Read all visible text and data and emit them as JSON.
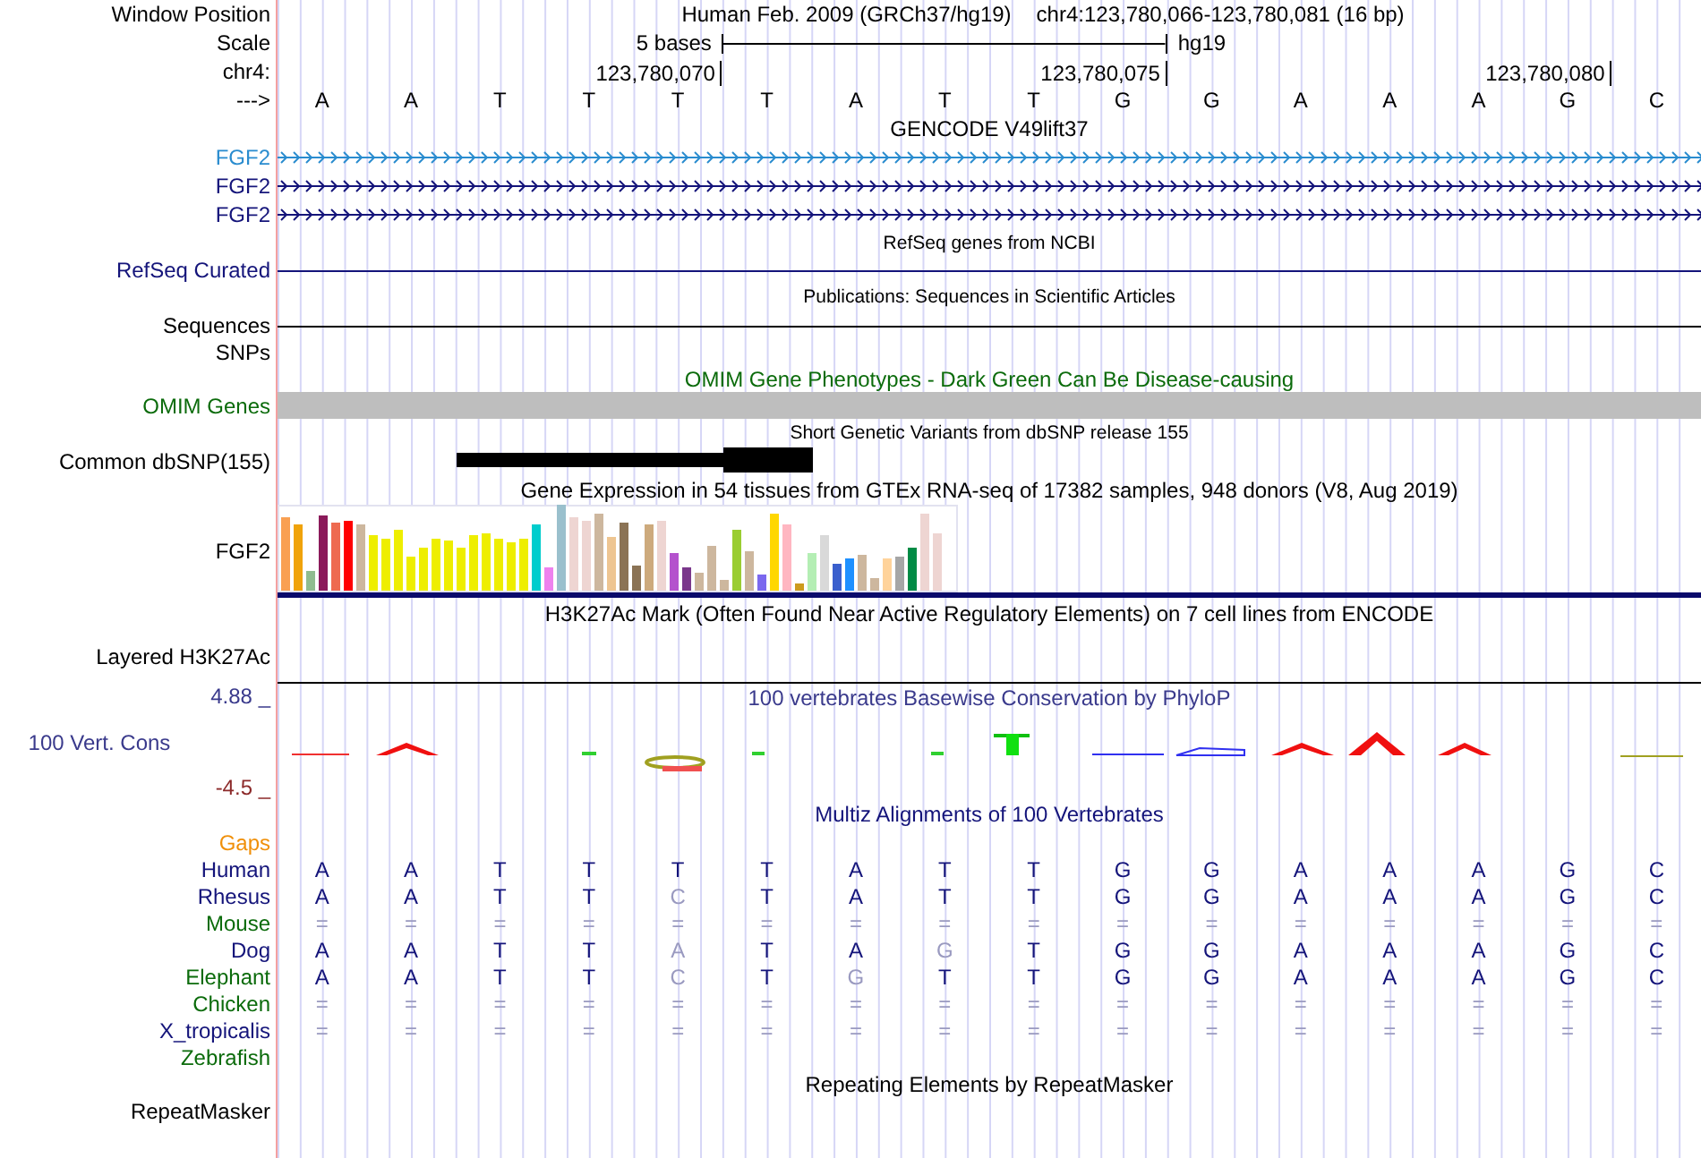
{
  "window_position": {
    "label": "Window Position",
    "assembly": "Human Feb. 2009 (GRCh37/hg19)",
    "range": "chr4:123,780,066-123,780,081 (16 bp)"
  },
  "scale": {
    "label": "Scale",
    "length": "5 bases",
    "assembly": "hg19"
  },
  "ruler": {
    "label": "chr4:",
    "ticks": [
      "123,780,070",
      "123,780,075",
      "123,780,080"
    ]
  },
  "sequence": {
    "label": "--->",
    "bases": [
      "A",
      "A",
      "T",
      "T",
      "T",
      "T",
      "A",
      "T",
      "T",
      "G",
      "G",
      "A",
      "A",
      "A",
      "G",
      "C"
    ]
  },
  "tracks": [
    {
      "kind": "genes",
      "title": "GENCODE V49lift37",
      "rows": [
        {
          "label": "FGF2",
          "color": "#2a8ccf"
        },
        {
          "label": "FGF2",
          "color": "#14147a"
        },
        {
          "label": "FGF2",
          "color": "#14147a"
        }
      ]
    },
    {
      "kind": "line",
      "title": "RefSeq genes from NCBI",
      "labels": [
        "RefSeq Curated"
      ],
      "color": "#14147a"
    },
    {
      "kind": "line",
      "title": "Publications: Sequences in Scientific Articles",
      "labels": [
        "Sequences",
        "SNPs"
      ],
      "color": "#000000"
    },
    {
      "kind": "bar",
      "title": "OMIM Gene Phenotypes - Dark Green Can Be Disease-causing",
      "labels": [
        "OMIM Genes"
      ],
      "color": "#0b6b0b"
    },
    {
      "kind": "variant",
      "title": "Short Genetic Variants from dbSNP release 155",
      "labels": [
        "Common dbSNP(155)"
      ],
      "color": "#000000"
    },
    {
      "kind": "expression",
      "title": "Gene Expression in 54 tissues from GTEx RNA-seq of 17382 samples, 948 donors (V8, Aug 2019)",
      "labels": [
        "FGF2"
      ],
      "color": "#000000"
    },
    {
      "kind": "signal",
      "title": "H3K27Ac Mark (Often Found Near Active Regulatory Elements) on 7 cell lines from ENCODE",
      "labels": [
        "Layered H3K27Ac"
      ],
      "color": "#000000"
    },
    {
      "kind": "conservation",
      "title": "100 vertebrates Basewise Conservation by PhyloP",
      "labels": [
        "100 Vert. Cons"
      ],
      "max": "4.88 _",
      "min": "-4.5 _",
      "color": "#3a3a8c"
    },
    {
      "kind": "alignment",
      "title": "Multiz Alignments of 100 Vertebrates",
      "color": "#14147a",
      "species": [
        {
          "name": "Gaps",
          "color": "#f0900a"
        },
        {
          "name": "Human",
          "color": "#14147a",
          "bases": [
            {
              "base": "A",
              "faded": false
            },
            {
              "base": "A",
              "faded": false
            },
            {
              "base": "T",
              "faded": false
            },
            {
              "base": "T",
              "faded": false
            },
            {
              "base": "T",
              "faded": false
            },
            {
              "base": "T",
              "faded": false
            },
            {
              "base": "A",
              "faded": false
            },
            {
              "base": "T",
              "faded": false
            },
            {
              "base": "T",
              "faded": false
            },
            {
              "base": "G",
              "faded": false
            },
            {
              "base": "G",
              "faded": false
            },
            {
              "base": "A",
              "faded": false
            },
            {
              "base": "A",
              "faded": false
            },
            {
              "base": "A",
              "faded": false
            },
            {
              "base": "G",
              "faded": false
            },
            {
              "base": "C",
              "faded": false
            }
          ]
        },
        {
          "name": "Rhesus",
          "color": "#14147a",
          "bases": [
            {
              "base": "A",
              "faded": false
            },
            {
              "base": "A",
              "faded": false
            },
            {
              "base": "T",
              "faded": false
            },
            {
              "base": "T",
              "faded": false
            },
            {
              "base": "C",
              "faded": true
            },
            {
              "base": "T",
              "faded": false
            },
            {
              "base": "A",
              "faded": false
            },
            {
              "base": "T",
              "faded": false
            },
            {
              "base": "T",
              "faded": false
            },
            {
              "base": "G",
              "faded": false
            },
            {
              "base": "G",
              "faded": false
            },
            {
              "base": "A",
              "faded": false
            },
            {
              "base": "A",
              "faded": false
            },
            {
              "base": "A",
              "faded": false
            },
            {
              "base": "G",
              "faded": false
            },
            {
              "base": "C",
              "faded": false
            }
          ]
        },
        {
          "name": "Mouse",
          "color": "#0b6b0b",
          "bases": [
            {
              "base": "=",
              "faded": true
            },
            {
              "base": "=",
              "faded": true
            },
            {
              "base": "=",
              "faded": true
            },
            {
              "base": "=",
              "faded": true
            },
            {
              "base": "=",
              "faded": true
            },
            {
              "base": "=",
              "faded": true
            },
            {
              "base": "=",
              "faded": true
            },
            {
              "base": "=",
              "faded": true
            },
            {
              "base": "=",
              "faded": true
            },
            {
              "base": "=",
              "faded": true
            },
            {
              "base": "=",
              "faded": true
            },
            {
              "base": "=",
              "faded": true
            },
            {
              "base": "=",
              "faded": true
            },
            {
              "base": "=",
              "faded": true
            },
            {
              "base": "=",
              "faded": true
            },
            {
              "base": "=",
              "faded": true
            }
          ]
        },
        {
          "name": "Dog",
          "color": "#14147a",
          "bases": [
            {
              "base": "A",
              "faded": false
            },
            {
              "base": "A",
              "faded": false
            },
            {
              "base": "T",
              "faded": false
            },
            {
              "base": "T",
              "faded": false
            },
            {
              "base": "A",
              "faded": true
            },
            {
              "base": "T",
              "faded": false
            },
            {
              "base": "A",
              "faded": false
            },
            {
              "base": "G",
              "faded": true
            },
            {
              "base": "T",
              "faded": false
            },
            {
              "base": "G",
              "faded": false
            },
            {
              "base": "G",
              "faded": false
            },
            {
              "base": "A",
              "faded": false
            },
            {
              "base": "A",
              "faded": false
            },
            {
              "base": "A",
              "faded": false
            },
            {
              "base": "G",
              "faded": false
            },
            {
              "base": "C",
              "faded": false
            }
          ]
        },
        {
          "name": "Elephant",
          "color": "#0b6b0b",
          "bases": [
            {
              "base": "A",
              "faded": false
            },
            {
              "base": "A",
              "faded": false
            },
            {
              "base": "T",
              "faded": false
            },
            {
              "base": "T",
              "faded": false
            },
            {
              "base": "C",
              "faded": true
            },
            {
              "base": "T",
              "faded": false
            },
            {
              "base": "G",
              "faded": true
            },
            {
              "base": "T",
              "faded": false
            },
            {
              "base": "T",
              "faded": false
            },
            {
              "base": "G",
              "faded": false
            },
            {
              "base": "G",
              "faded": false
            },
            {
              "base": "A",
              "faded": false
            },
            {
              "base": "A",
              "faded": false
            },
            {
              "base": "A",
              "faded": false
            },
            {
              "base": "G",
              "faded": false
            },
            {
              "base": "C",
              "faded": false
            }
          ]
        },
        {
          "name": "Chicken",
          "color": "#0b6b0b",
          "bases": [
            {
              "base": "=",
              "faded": true
            },
            {
              "base": "=",
              "faded": true
            },
            {
              "base": "=",
              "faded": true
            },
            {
              "base": "=",
              "faded": true
            },
            {
              "base": "=",
              "faded": true
            },
            {
              "base": "=",
              "faded": true
            },
            {
              "base": "=",
              "faded": true
            },
            {
              "base": "=",
              "faded": true
            },
            {
              "base": "=",
              "faded": true
            },
            {
              "base": "=",
              "faded": true
            },
            {
              "base": "=",
              "faded": true
            },
            {
              "base": "=",
              "faded": true
            },
            {
              "base": "=",
              "faded": true
            },
            {
              "base": "=",
              "faded": true
            },
            {
              "base": "=",
              "faded": true
            },
            {
              "base": "=",
              "faded": true
            }
          ]
        },
        {
          "name": "X_tropicalis",
          "color": "#14147a",
          "bases": [
            {
              "base": "=",
              "faded": true
            },
            {
              "base": "=",
              "faded": true
            },
            {
              "base": "=",
              "faded": true
            },
            {
              "base": "=",
              "faded": true
            },
            {
              "base": "=",
              "faded": true
            },
            {
              "base": "=",
              "faded": true
            },
            {
              "base": "=",
              "faded": true
            },
            {
              "base": "=",
              "faded": true
            },
            {
              "base": "=",
              "faded": true
            },
            {
              "base": "=",
              "faded": true
            },
            {
              "base": "=",
              "faded": true
            },
            {
              "base": "=",
              "faded": true
            },
            {
              "base": "=",
              "faded": true
            },
            {
              "base": "=",
              "faded": true
            },
            {
              "base": "=",
              "faded": true
            },
            {
              "base": "=",
              "faded": true
            }
          ]
        },
        {
          "name": "Zebrafish",
          "color": "#0b6b0b"
        }
      ]
    },
    {
      "kind": "repeats",
      "title": "Repeating Elements by RepeatMasker",
      "labels": [
        "RepeatMasker"
      ],
      "color": "#000000"
    }
  ]
}
